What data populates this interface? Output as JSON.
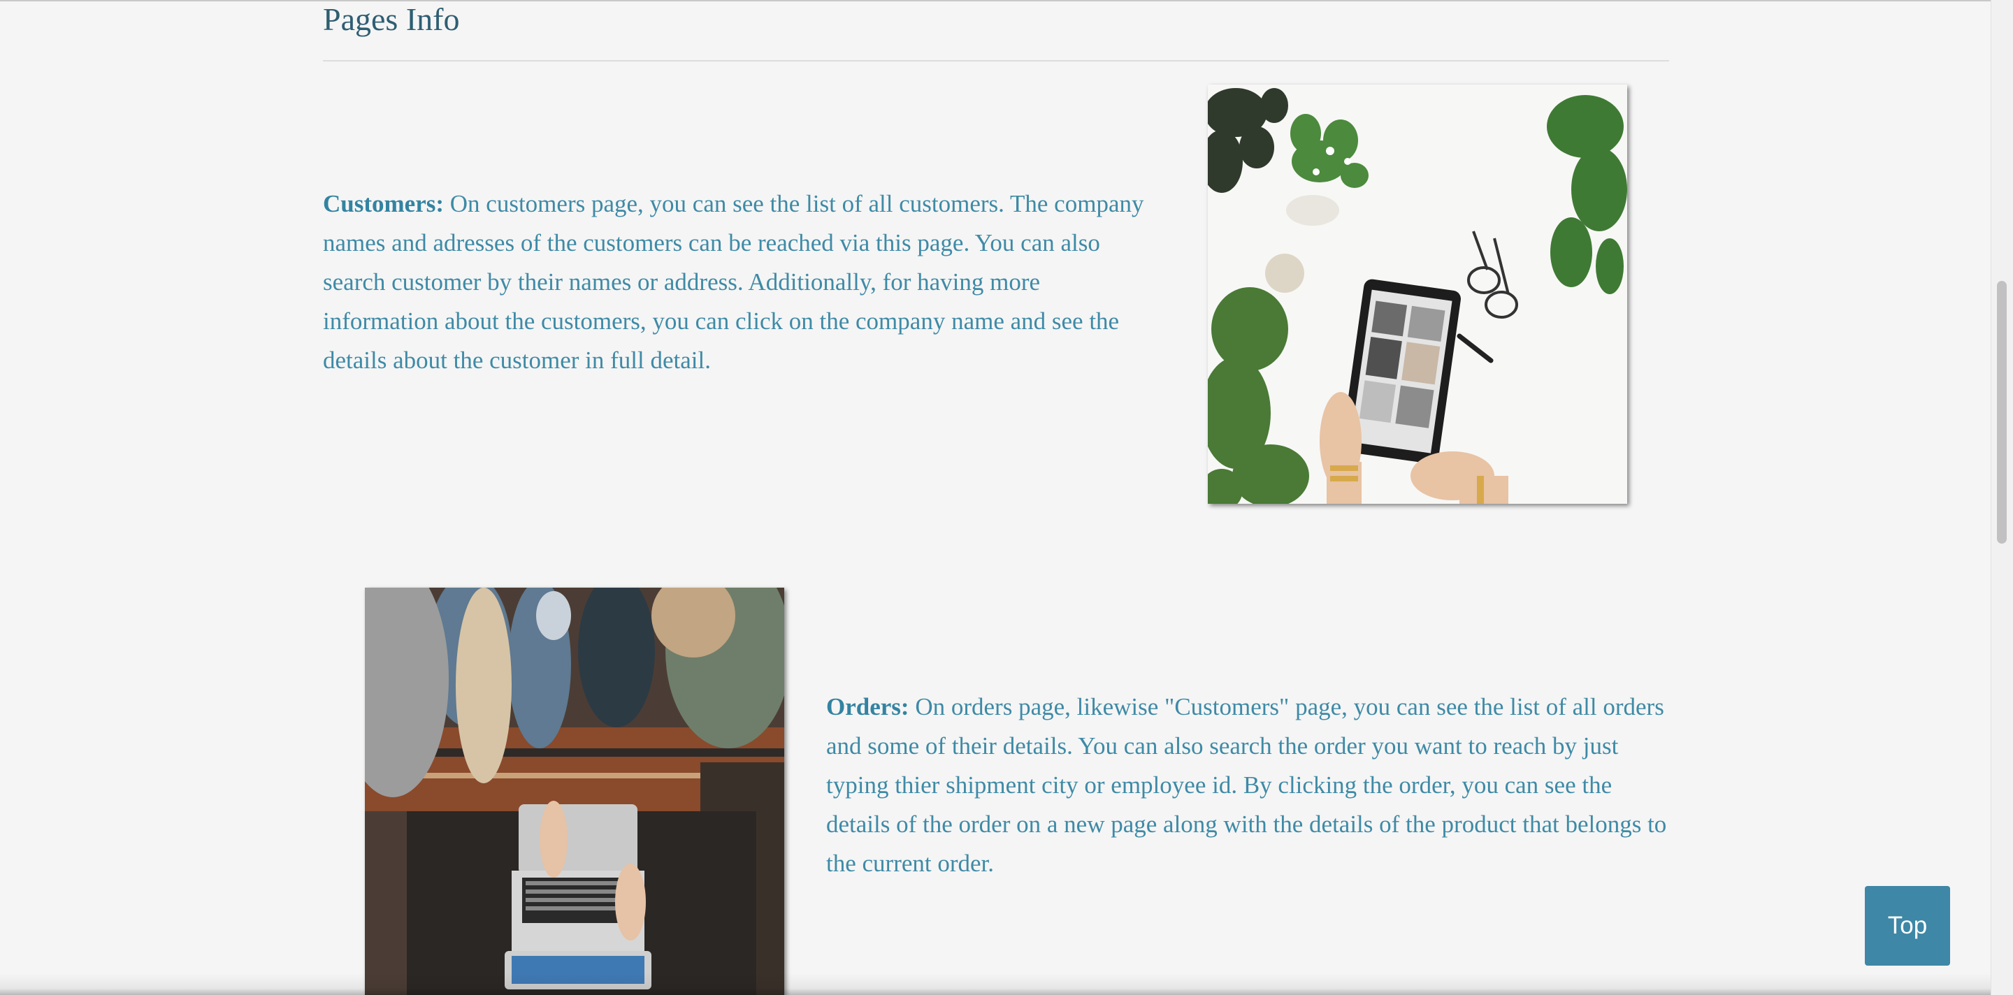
{
  "pages_info": {
    "title": "Pages Info",
    "customers": {
      "label": "Customers:",
      "text": " On customers page, you can see the list of all customers. The company names and adresses of the customers can be reached via this page. You can also search customer by their names or address. Additionally, for having more information about the customers, you can click on the company name and see the details about the customer in full detail."
    },
    "orders": {
      "label": "Orders:",
      "text": " On orders page, likewise \"Customers\" page, you can see the list of all orders and some of their details. You can also search the order you want to reach by just typing thier shipment city or employee id. By clicking the order, you can see the details of the order on a new page along with the details of the product that belongs to the current order."
    }
  },
  "top_button": {
    "label": "Top"
  },
  "colors": {
    "heading": "#2e5e72",
    "text": "#3e8aa6",
    "button": "#3e87a6",
    "background": "#f5f5f5"
  }
}
